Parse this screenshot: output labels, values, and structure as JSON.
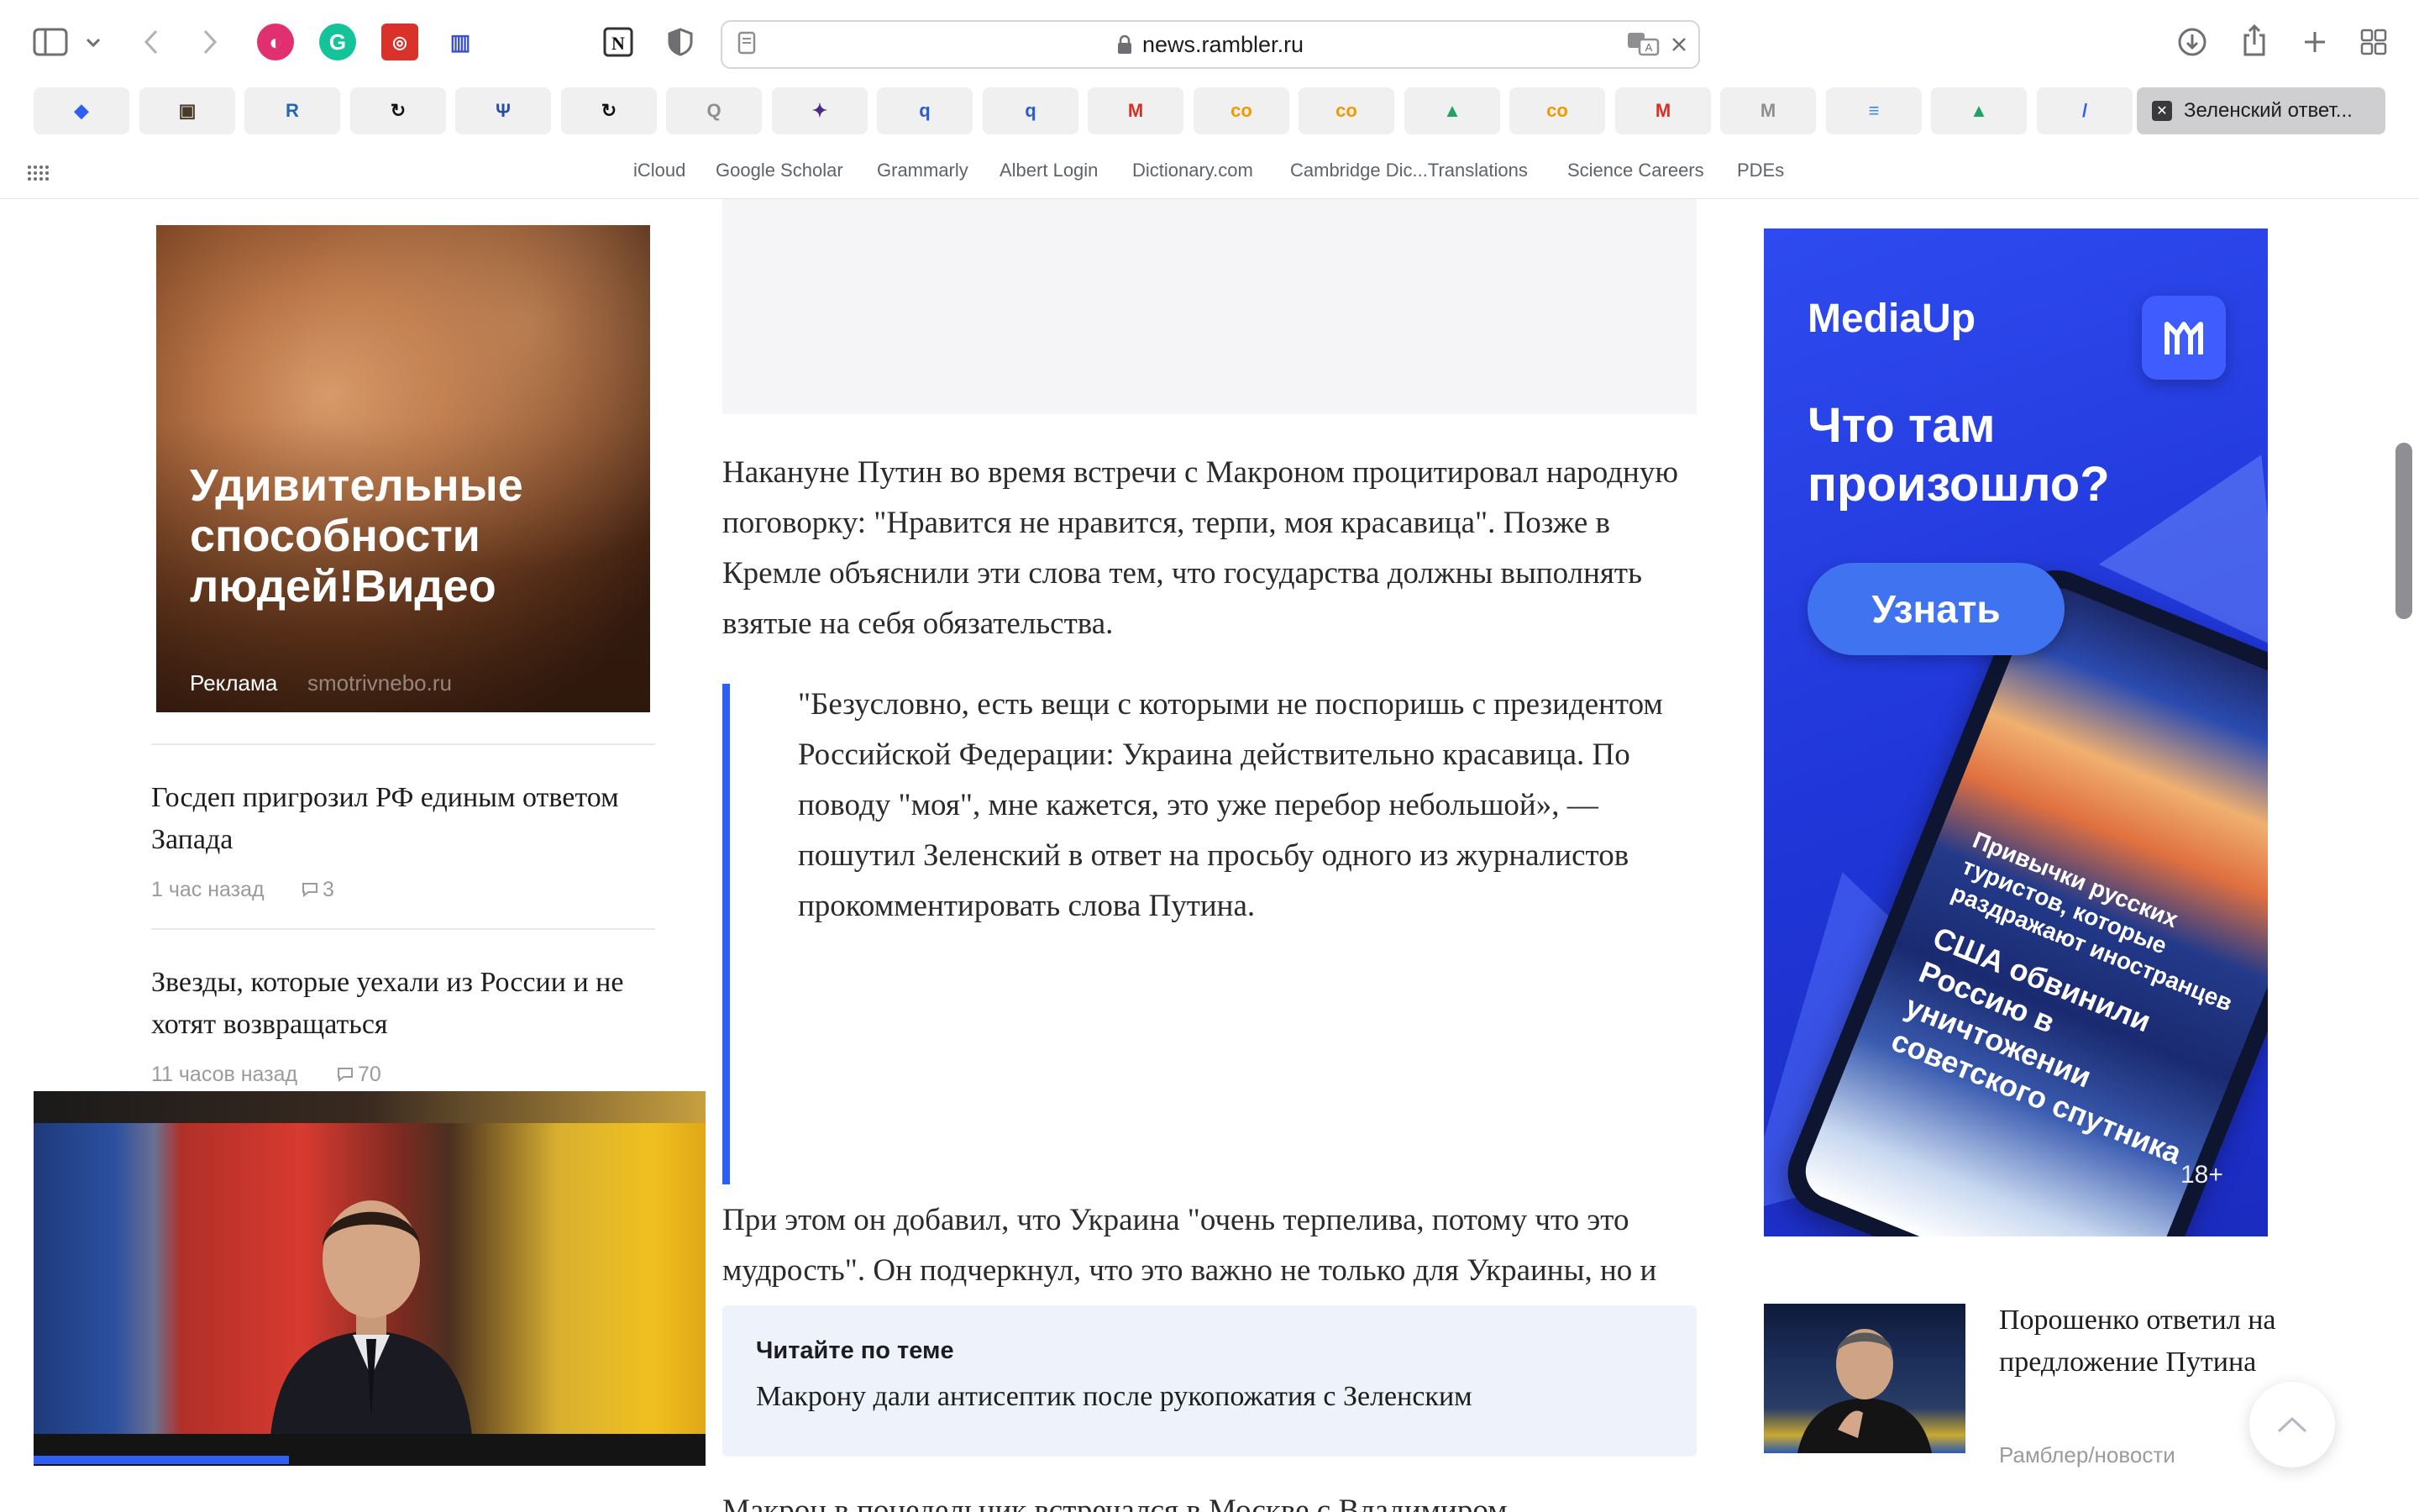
{
  "browser": {
    "url": "news.rambler.ru",
    "active_tab_title": "Зеленский ответ...",
    "pinned_tabs": [
      {
        "name": "layers",
        "glyph": "◆",
        "color": "#2d5ff5"
      },
      {
        "name": "photo",
        "glyph": "▣",
        "color": "#4a3a2a"
      },
      {
        "name": "r-lang",
        "glyph": "R",
        "color": "#2165b6"
      },
      {
        "name": "cycle-1",
        "glyph": "↻",
        "color": "#111111"
      },
      {
        "name": "psi",
        "glyph": "Ψ",
        "color": "#2a4da8"
      },
      {
        "name": "cycle-2",
        "glyph": "↻",
        "color": "#111111"
      },
      {
        "name": "quora-q",
        "glyph": "Q",
        "color": "#8e8e93"
      },
      {
        "name": "purple-app",
        "glyph": "✦",
        "color": "#4b2a8a"
      },
      {
        "name": "q-blue-1",
        "glyph": "q",
        "color": "#2a5bd7"
      },
      {
        "name": "q-blue-2",
        "glyph": "q",
        "color": "#2a5bd7"
      },
      {
        "name": "gmail-1",
        "glyph": "M",
        "color": "#d93025"
      },
      {
        "name": "co-1",
        "glyph": "co",
        "color": "#f29900"
      },
      {
        "name": "co-2",
        "glyph": "co",
        "color": "#f29900"
      },
      {
        "name": "drive-1",
        "glyph": "▲",
        "color": "#1fa463"
      },
      {
        "name": "co-3",
        "glyph": "co",
        "color": "#f29900"
      },
      {
        "name": "gmail-2",
        "glyph": "M",
        "color": "#d93025"
      },
      {
        "name": "m-gray",
        "glyph": "M",
        "color": "#8e8e93"
      },
      {
        "name": "docs",
        "glyph": "≡",
        "color": "#4285f4"
      },
      {
        "name": "drive-2",
        "glyph": "▲",
        "color": "#1fa463"
      },
      {
        "name": "slash",
        "glyph": "/",
        "color": "#2d5ff5"
      }
    ],
    "bookmarks": [
      "iCloud",
      "Google Scholar",
      "Grammarly",
      "Albert Login",
      "Dictionary.com",
      "Cambridge Dic...Translations",
      "Science Careers",
      "PDEs"
    ]
  },
  "left": {
    "ad": {
      "title": "Удивительные способности людей!Видео",
      "label": "Реклама",
      "source": "smotrivnebo.ru"
    },
    "news": [
      {
        "title": "Госдеп пригрозил РФ единым ответом Запада",
        "time": "1 час назад",
        "comments": "3"
      },
      {
        "title": "Звезды, которые уехали из России и не хотят возвращаться",
        "time": "11 часов назад",
        "comments": "70"
      }
    ]
  },
  "article": {
    "paragraph1": "Накануне Путин во время встречи с Макроном процитировал народную поговорку: \"Нравится не нравится, терпи, моя красавица\". Позже в Кремле объяснили эти слова тем, что государства должны выполнять взятые на себя обязательства.",
    "quote": "\"Безусловно, есть вещи с которыми не поспоришь с президентом Российской Федерации: Украина действительно красавица. По поводу \"моя\", мне кажется, это уже перебор небольшой», — пошутил Зеленский в ответ на просьбу одного из журналистов прокомментировать слова Путина.",
    "paragraph2": "При этом он добавил, что Украина \"очень терпелива, потому что это мудрость\". Он подчеркнул, что это важно не только для Украины, но и для всей Европы, а также для россиян. Зеленский также отметил, что Украина не отвечает на провокации и ведет себя очень достойно.",
    "related_label": "Читайте по теме",
    "related_link": "Макрону дали антисептик после рукопожатия с Зеленским",
    "next_paragraph_start": "Макрон в понедельник встречался в Москве с Владимиром"
  },
  "right": {
    "ad": {
      "brand": "MediaUp",
      "headline": "Что там произошло?",
      "button": "Узнать",
      "phone_headline_1": "Привычки русских туристов, которые раздражают иностранцев",
      "phone_headline_2": "США обвинили Россию в уничтожении советского спутника",
      "age_rating": "18+"
    },
    "news": {
      "title": "Порошенко ответил на предложение Путина",
      "source": "Рамблер/новости"
    }
  },
  "video": {
    "progress": 0.38
  },
  "colors": {
    "accent": "#2d5ff5",
    "related_bg": "#edf2fb",
    "meta_gray": "#9a9aa0"
  }
}
